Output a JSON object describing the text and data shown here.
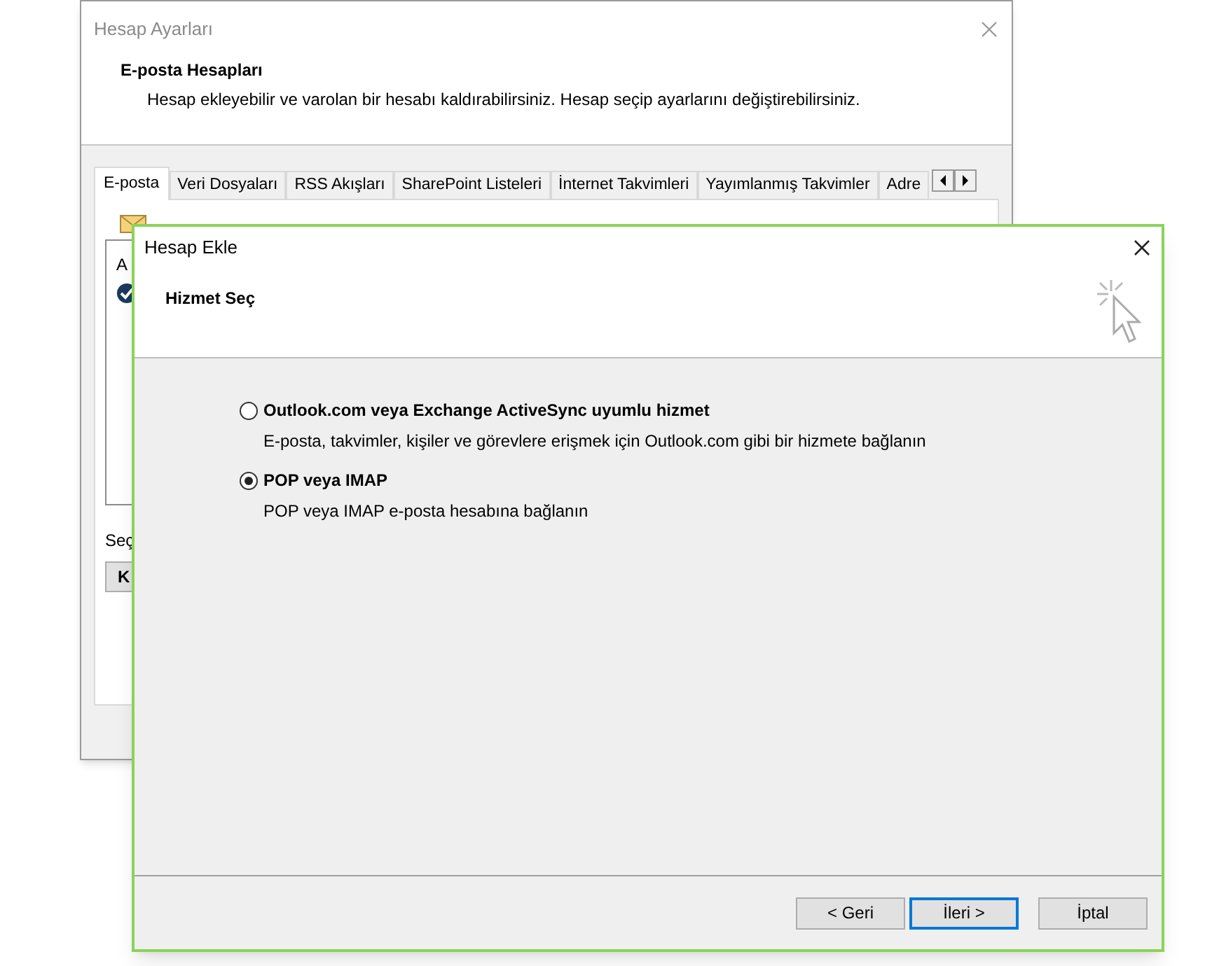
{
  "back_window": {
    "title": "Hesap Ayarları",
    "heading": "E-posta Hesapları",
    "description": "Hesap ekleyebilir ve varolan bir hesabı kaldırabilirsiniz. Hesap seçip ayarlarını değiştirebilirsiniz.",
    "tabs": [
      {
        "label": "E-posta",
        "selected": true
      },
      {
        "label": "Veri Dosyaları",
        "selected": false
      },
      {
        "label": "RSS Akışları",
        "selected": false
      },
      {
        "label": "SharePoint Listeleri",
        "selected": false
      },
      {
        "label": "İnternet Takvimleri",
        "selected": false
      },
      {
        "label": "Yayımlanmış Takvimler",
        "selected": false
      },
      {
        "label": "Adre",
        "selected": false
      }
    ],
    "list_header": "A",
    "selection_label": "Seç",
    "button": "K"
  },
  "dialog": {
    "title": "Hesap Ekle",
    "heading": "Hizmet Seç",
    "options": [
      {
        "label": "Outlook.com veya Exchange ActiveSync uyumlu hizmet",
        "description": "E-posta, takvimler, kişiler ve görevlere erişmek için Outlook.com gibi bir hizmete bağlanın",
        "selected": false
      },
      {
        "label": "POP veya IMAP",
        "description": "POP veya IMAP e-posta hesabına bağlanın",
        "selected": true
      }
    ],
    "buttons": [
      {
        "label": "< Geri",
        "focused": false
      },
      {
        "label": "İleri >",
        "focused": true
      },
      {
        "label": "İptal",
        "focused": false
      }
    ]
  }
}
